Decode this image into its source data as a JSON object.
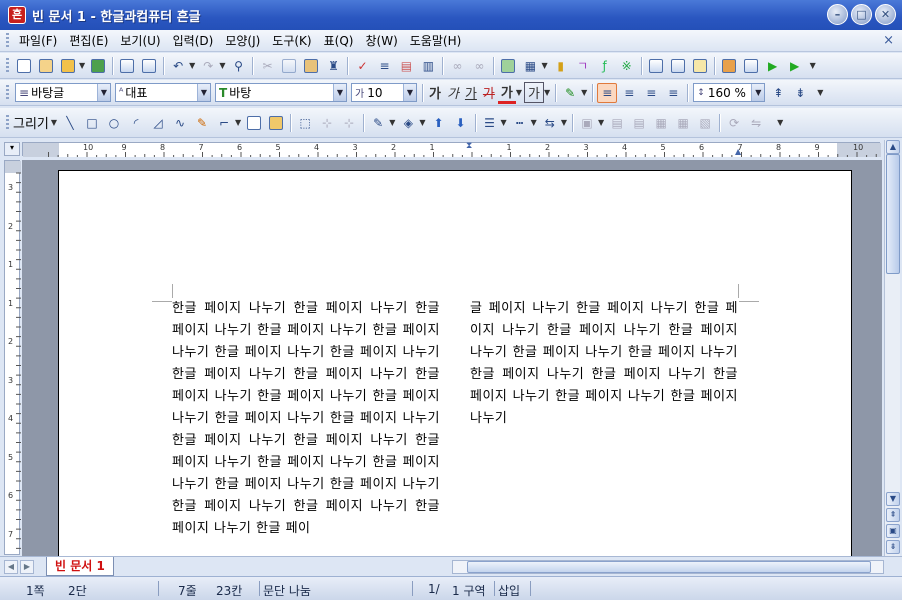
{
  "window": {
    "title": "빈 문서 1 - 한글과컴퓨터 흔글",
    "app_icon": "흔"
  },
  "menu": [
    "파일(F)",
    "편집(E)",
    "보기(U)",
    "입력(D)",
    "모양(J)",
    "도구(K)",
    "표(Q)",
    "창(W)",
    "도움말(H)"
  ],
  "format": {
    "style": "바탕글",
    "language": "대표",
    "font": "바탕",
    "size": "10",
    "line_spacing": "160 %",
    "bold": "가",
    "italic": "가",
    "underline": "가",
    "strike": "가",
    "color_char": "가",
    "shade_char": "가"
  },
  "draw": {
    "label": "그리기"
  },
  "ruler": {
    "top_left": [
      "10",
      "9",
      "8",
      "7",
      "6",
      "5",
      "4",
      "3",
      "2",
      "1"
    ],
    "top_right": [
      "1",
      "2",
      "3",
      "4",
      "5",
      "6",
      "7",
      "8",
      "9",
      "10"
    ],
    "left": [
      "3",
      "2",
      "1",
      "1",
      "2",
      "3",
      "4",
      "5",
      "6",
      "7"
    ]
  },
  "document": {
    "col1": "한글 페이지 나누기 한글 페이지 나누기 한글 페이지 나누기 한글 페이지 나누기 한글 페이지 나누기 한글 페이지 나누기 한글 페이지 나누기 한글 페이지 나누기 한글 페이지 나누기 한글 페이지 나누기 한글 페이지 나누기 한글 페이지 나누기 한글 페이지 나누기 한글 페이지 나누기 한글 페이지 나누기 한글 페이지 나누기 한글 페이지 나누기 한글 페이지 나누기 한글 페이지 나누기 한글 페이지 나누기 한글 페이지 나누기 한글 페이지 나누기 한글 페이지 나누기 한글 페이지 나누기 한글 페이",
    "col2": "글 페이지 나누기 한글 페이지 나누기 한글 페이지 나누기 한글 페이지 나누기 한글 페이지 나누기 한글 페이지 나누기 한글 페이지 나누기 한글 페이지 나누기 한글 페이지 나누기 한글 페이지 나누기 한글 페이지 나누기 한글 페이지 나누기"
  },
  "tabs": {
    "doc_tab": "빈 문서 1"
  },
  "status": {
    "page": "1쪽",
    "column": "2단",
    "line": "7줄",
    "col": "23칸",
    "section_break": "문단 나눔",
    "page_frac": "1/",
    "section": "1 구역",
    "mode": "삽입"
  },
  "colors": {
    "accent": "#2a56c0",
    "tab_text": "#d01010"
  }
}
